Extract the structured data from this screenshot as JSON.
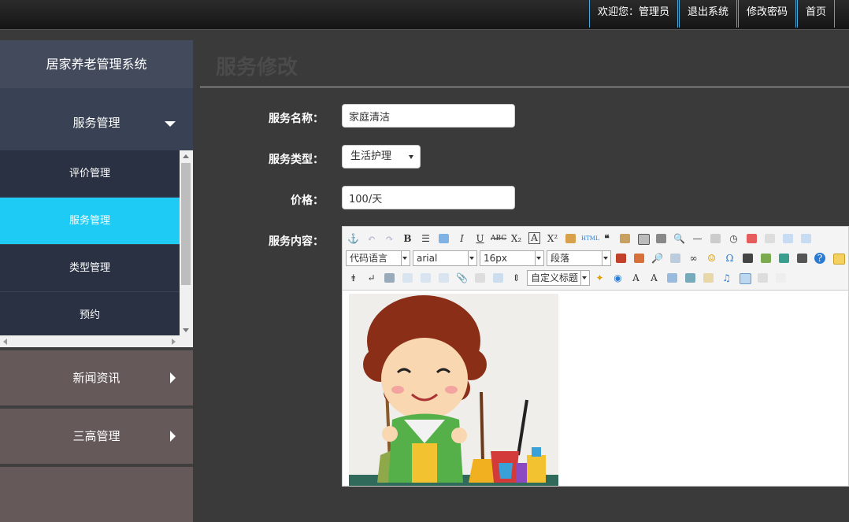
{
  "topbar": {
    "welcome": "欢迎您：管理员",
    "logout": "退出系统",
    "change_password": "修改密码",
    "home": "首页"
  },
  "sidebar": {
    "system_title": "居家养老管理系统",
    "expanded_group": "服务管理",
    "sub_items": [
      "评价管理",
      "服务管理",
      "类型管理",
      "预约"
    ],
    "active_index": 1,
    "groups": [
      "新闻资讯",
      "三高管理"
    ]
  },
  "main": {
    "page_title": "服务修改",
    "form": {
      "name_label": "服务名称：",
      "name_value": "家庭清洁",
      "type_label": "服务类型：",
      "type_value": "生活护理",
      "price_label": "价格：",
      "price_value": "100/天",
      "content_label": "服务内容："
    },
    "editor": {
      "combo_code_language": "代码语言",
      "combo_font_family": "arial",
      "combo_font_size": "16px",
      "combo_paragraph": "段落",
      "combo_custom_title": "自定义标题"
    }
  },
  "colors": {
    "active_item": "#1ecbf5",
    "sidebar_dark": "#2a3143",
    "group_muted": "#655959",
    "main_background": "#3a3a3a"
  }
}
